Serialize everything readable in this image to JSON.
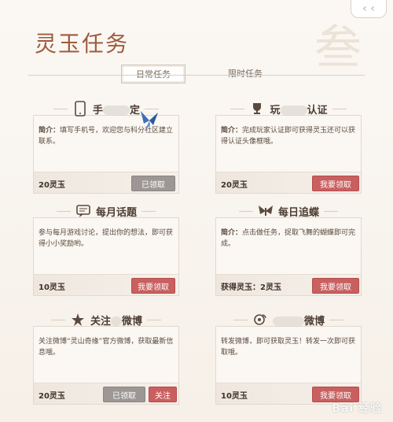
{
  "page": {
    "title": "灵玉任务",
    "deco_char": "叁",
    "back_icon": "‹ ‹"
  },
  "tabs": [
    {
      "label": "日常任务",
      "active": true
    },
    {
      "label": "限时任务",
      "active": false
    }
  ],
  "tasks": [
    {
      "icon": "phone-icon",
      "title_pre": "手",
      "title_post": "定",
      "desc_prefix": "简介：",
      "desc": "填写手机号，欢迎您与科分社区建立联系。",
      "reward": "20灵玉",
      "buttons": [
        {
          "label": "已领取",
          "style": "gray"
        }
      ]
    },
    {
      "icon": "trophy-icon",
      "title_pre": "玩",
      "title_post": "认证",
      "desc_prefix": "简介：",
      "desc": "完成玩家认证即可获得灵玉还可以获得认证头像框哦。",
      "reward": "20灵玉",
      "buttons": [
        {
          "label": "我要领取",
          "style": "red"
        }
      ]
    },
    {
      "icon": "chat-icon",
      "title": "每月话题",
      "desc": "参与每月游戏讨论，提出你的想法，即可获得小小奖励哟。",
      "reward": "10灵玉",
      "buttons": [
        {
          "label": "我要领取",
          "style": "red"
        }
      ]
    },
    {
      "icon": "butterfly-icon",
      "title": "每日追蝶",
      "desc_prefix": "简介：",
      "desc": "点击做任务，捉取飞舞的蝴蝶即可完成。",
      "reward": "获得灵玉：2灵玉",
      "buttons": [
        {
          "label": "我要领取",
          "style": "red"
        }
      ]
    },
    {
      "icon": "star-icon",
      "title_pre": "关注",
      "title_post": "微博",
      "desc": "关注微博“灵山奇缘”官方微博，获取最新信息哦。",
      "reward": "20灵玉",
      "buttons": [
        {
          "label": "已领取",
          "style": "gray"
        },
        {
          "label": "关注",
          "style": "red"
        }
      ]
    },
    {
      "icon": "weibo-icon",
      "title_pre": "",
      "title_post": "微博",
      "desc": "转发微博，即可获取灵玉！转发一次即可获取哦。",
      "reward": "10灵玉",
      "buttons": [
        {
          "label": "我要领取",
          "style": "red"
        }
      ]
    }
  ],
  "watermark": "Bai 经验"
}
